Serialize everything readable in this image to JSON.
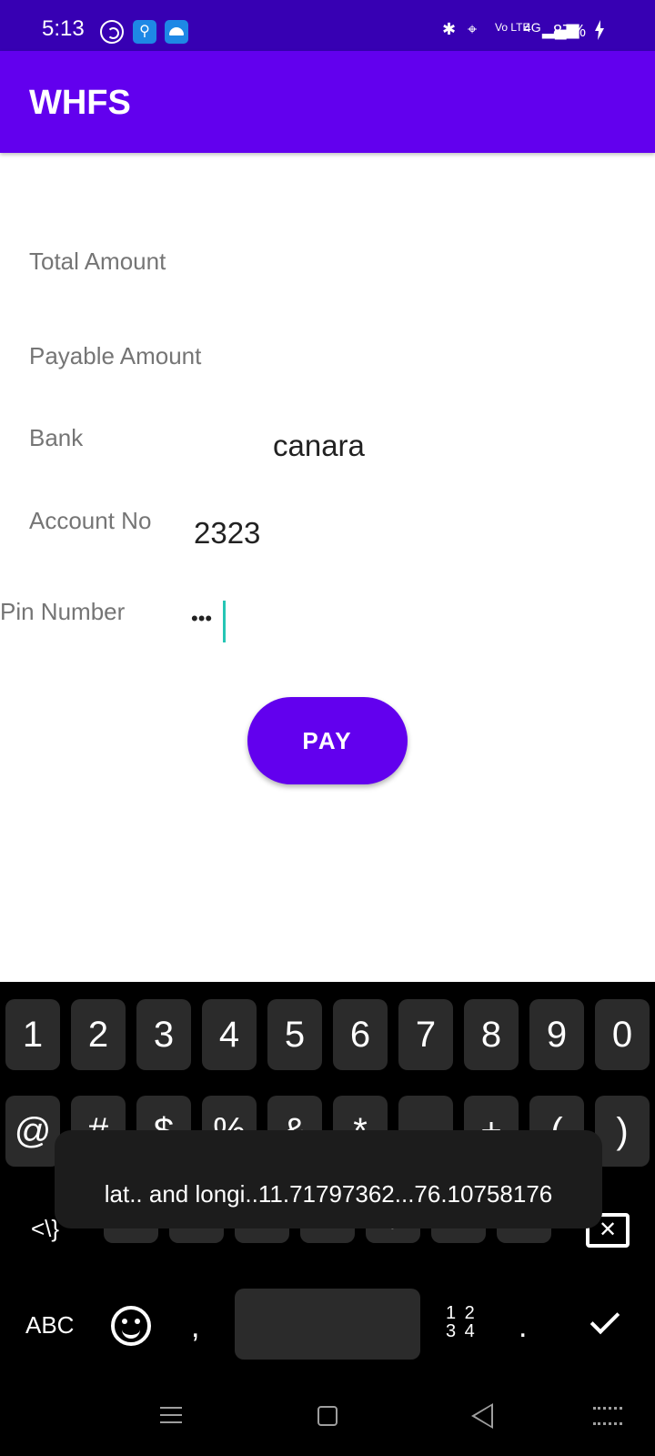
{
  "status_bar": {
    "time": "5:13",
    "usb_icon": "usb-icon",
    "battery": "87%",
    "network": "4G",
    "volte": "Vo LTE"
  },
  "app_bar": {
    "title": "WHFS",
    "color": "#6200ee"
  },
  "form": {
    "total_amount_label": "Total Amount",
    "payable_amount_label": "Payable Amount",
    "bank_label": "Bank",
    "bank_value": "canara",
    "account_label": "Account No",
    "account_value": "2323",
    "pin_label": "Pin Number",
    "pin_value": "•••"
  },
  "pay_button": {
    "label": "PAY"
  },
  "keyboard": {
    "numbers": [
      "1",
      "2",
      "3",
      "4",
      "5",
      "6",
      "7",
      "8",
      "9",
      "0"
    ],
    "symbols_row": [
      "@",
      "#",
      "$",
      "%",
      "&",
      "*",
      "-",
      "+",
      "(",
      ")"
    ],
    "symbols_row3": [
      "!",
      "\"",
      "'",
      ":",
      ";",
      "/",
      "?"
    ],
    "switch_left": "<\\}",
    "abc": "ABC",
    "comma": ",",
    "numpad": "1 2\n3 4",
    "period": "."
  },
  "toast": {
    "message": "lat.. and longi..11.71797362...76.10758176"
  }
}
